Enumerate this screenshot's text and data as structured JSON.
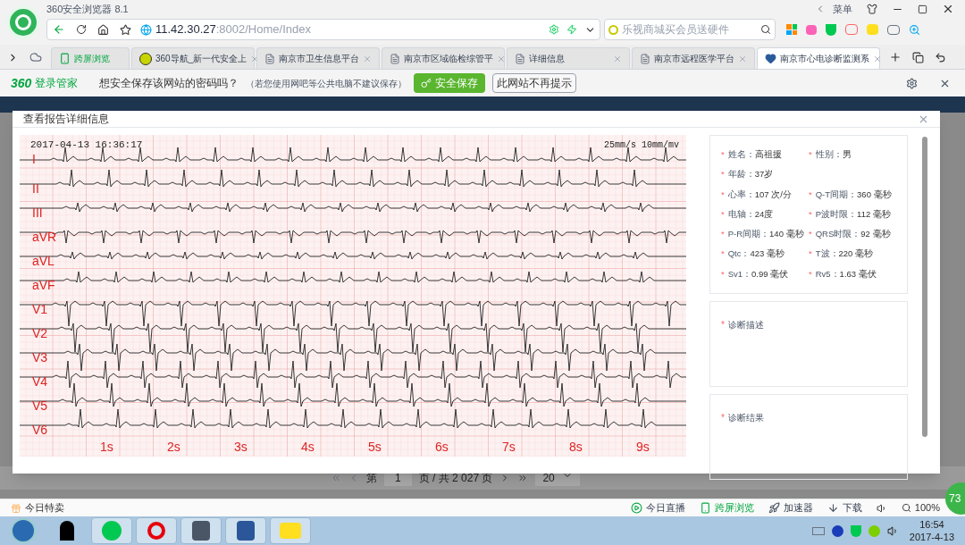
{
  "browser": {
    "title": "360安全浏览器 8.1",
    "url_host": "11.42.30.27",
    "url_path": ":8002/Home/Index",
    "search_placeholder": "乐视商城买会员送硬件",
    "menu": "菜单"
  },
  "tabs": [
    {
      "label": "跨屏浏览",
      "kind": "phone",
      "selected": false
    },
    {
      "label": "360导航_新一代安全上",
      "kind": "nav",
      "selected": false
    },
    {
      "label": "南京市卫生信息平台",
      "kind": "page",
      "selected": false
    },
    {
      "label": "南京市区域临检综管平",
      "kind": "page",
      "selected": false
    },
    {
      "label": "详细信息",
      "kind": "page",
      "selected": false
    },
    {
      "label": "南京市远程医学平台",
      "kind": "page",
      "selected": false
    },
    {
      "label": "南京市心电诊断监测系",
      "kind": "heart",
      "selected": true
    }
  ],
  "password_bar": {
    "brand": "360",
    "brand_name": "登录管家",
    "prompt": "想安全保存该网站的密码吗？",
    "note": "（若您使用网吧等公共电脑不建议保存）",
    "save_button": "安全保存",
    "never_button": "此网站不再提示"
  },
  "modal": {
    "title": "查看报告详细信息",
    "required_mark": "*",
    "separator": "：",
    "ecg": {
      "timestamp": "2017-04-13 16:36:17",
      "scale": "25mm/s 10mm/mv",
      "leads": [
        "I",
        "II",
        "III",
        "aVR",
        "aVL",
        "aVF",
        "V1",
        "V2",
        "V3",
        "V4",
        "V5",
        "V6"
      ],
      "seconds": [
        "1s",
        "2s",
        "3s",
        "4s",
        "5s",
        "6s",
        "7s",
        "8s",
        "9s"
      ]
    },
    "fields": [
      {
        "label": "姓名",
        "value": "高祖援",
        "kind": "half"
      },
      {
        "label": "性别",
        "value": "男",
        "kind": "half"
      },
      {
        "label": "年龄",
        "value": "37岁",
        "kind": "wide"
      },
      {
        "label": "心率",
        "value": "107 次/分",
        "kind": "half"
      },
      {
        "label": "Q-T间期",
        "value": "360 毫秒",
        "kind": "half"
      },
      {
        "label": "电轴",
        "value": "24度",
        "kind": "half"
      },
      {
        "label": "P波时限",
        "value": "112 毫秒",
        "kind": "half"
      },
      {
        "label": "P-R间期",
        "value": "140 毫秒",
        "kind": "half"
      },
      {
        "label": "QRS时限",
        "value": "92 毫秒",
        "kind": "half"
      },
      {
        "label": "Qtc",
        "value": "423 毫秒",
        "kind": "half"
      },
      {
        "label": "T波",
        "value": "220 毫秒",
        "kind": "half"
      },
      {
        "label": "Sv1",
        "value": "0.99 毫伏",
        "kind": "half"
      },
      {
        "label": "Rv5",
        "value": "1.63 毫伏",
        "kind": "half"
      }
    ],
    "sections": [
      {
        "label": "诊断描述"
      },
      {
        "label": "诊断结果"
      }
    ]
  },
  "pagination": {
    "page_label": "第",
    "page": "1",
    "total": "页 / 共 2 027 页",
    "page_size": "20"
  },
  "status_bar": {
    "left": "今日特卖",
    "items": [
      {
        "label": "今日直播",
        "kind": "play"
      },
      {
        "label": "跨屏浏览",
        "kind": "phone"
      },
      {
        "label": "加速器",
        "kind": "rocket"
      },
      {
        "label": "下载",
        "kind": "download"
      }
    ],
    "zoom": "100%"
  },
  "badge": "73",
  "taskbar": {
    "time": "16:54",
    "date": "2017-4-13"
  }
}
